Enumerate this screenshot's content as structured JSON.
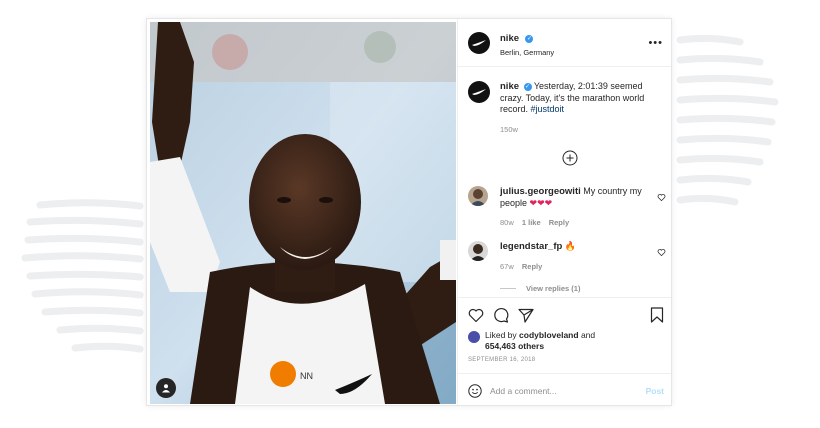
{
  "post": {
    "username": "nike",
    "verified_mark": "✓",
    "location": "Berlin, Germany",
    "more_label": "•••"
  },
  "caption": {
    "username": "nike",
    "text": "Yesterday, 2:01:39 seemed crazy. Today, it's the marathon world record.",
    "hashtag": "#justdoit",
    "age": "150w"
  },
  "comments": [
    {
      "username": "julius.georgeowiti",
      "text": "My country my people",
      "emoji": "❤❤❤",
      "age": "80w",
      "likes": "1 like",
      "reply": "Reply"
    },
    {
      "username": "legendstar_fp",
      "emoji": "🔥",
      "age": "67w",
      "reply": "Reply"
    }
  ],
  "view_replies": "View replies (1)",
  "likes": {
    "prefix": "Liked by",
    "user": "codybloveland",
    "conj": "and",
    "others": "654,463 others"
  },
  "date": "SEPTEMBER 16, 2018",
  "add_comment": {
    "placeholder": "Add a comment...",
    "post_label": "Post"
  },
  "colors": {
    "accent": "#3897f0",
    "post_disabled": "#b2dffc",
    "brand_orange": "#f07d00"
  },
  "icons": [
    "tag-user-icon",
    "more-icon",
    "load-more-icon",
    "heart-icon",
    "comment-icon",
    "share-icon",
    "bookmark-icon",
    "emoji-icon"
  ]
}
